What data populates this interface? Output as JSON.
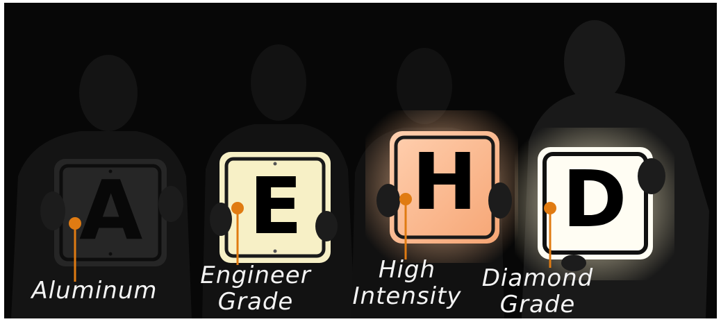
{
  "signs": [
    {
      "letter": "A",
      "caption": [
        "Aluminum"
      ]
    },
    {
      "letter": "E",
      "caption": [
        "Engineer",
        "Grade"
      ]
    },
    {
      "letter": "H",
      "caption": [
        "High",
        "Intensity"
      ]
    },
    {
      "letter": "D",
      "caption": [
        "Diamond",
        "Grade"
      ]
    }
  ],
  "colors": {
    "background": "#070707",
    "pointer": "#e07b12",
    "caption": "#f4f4f4"
  }
}
